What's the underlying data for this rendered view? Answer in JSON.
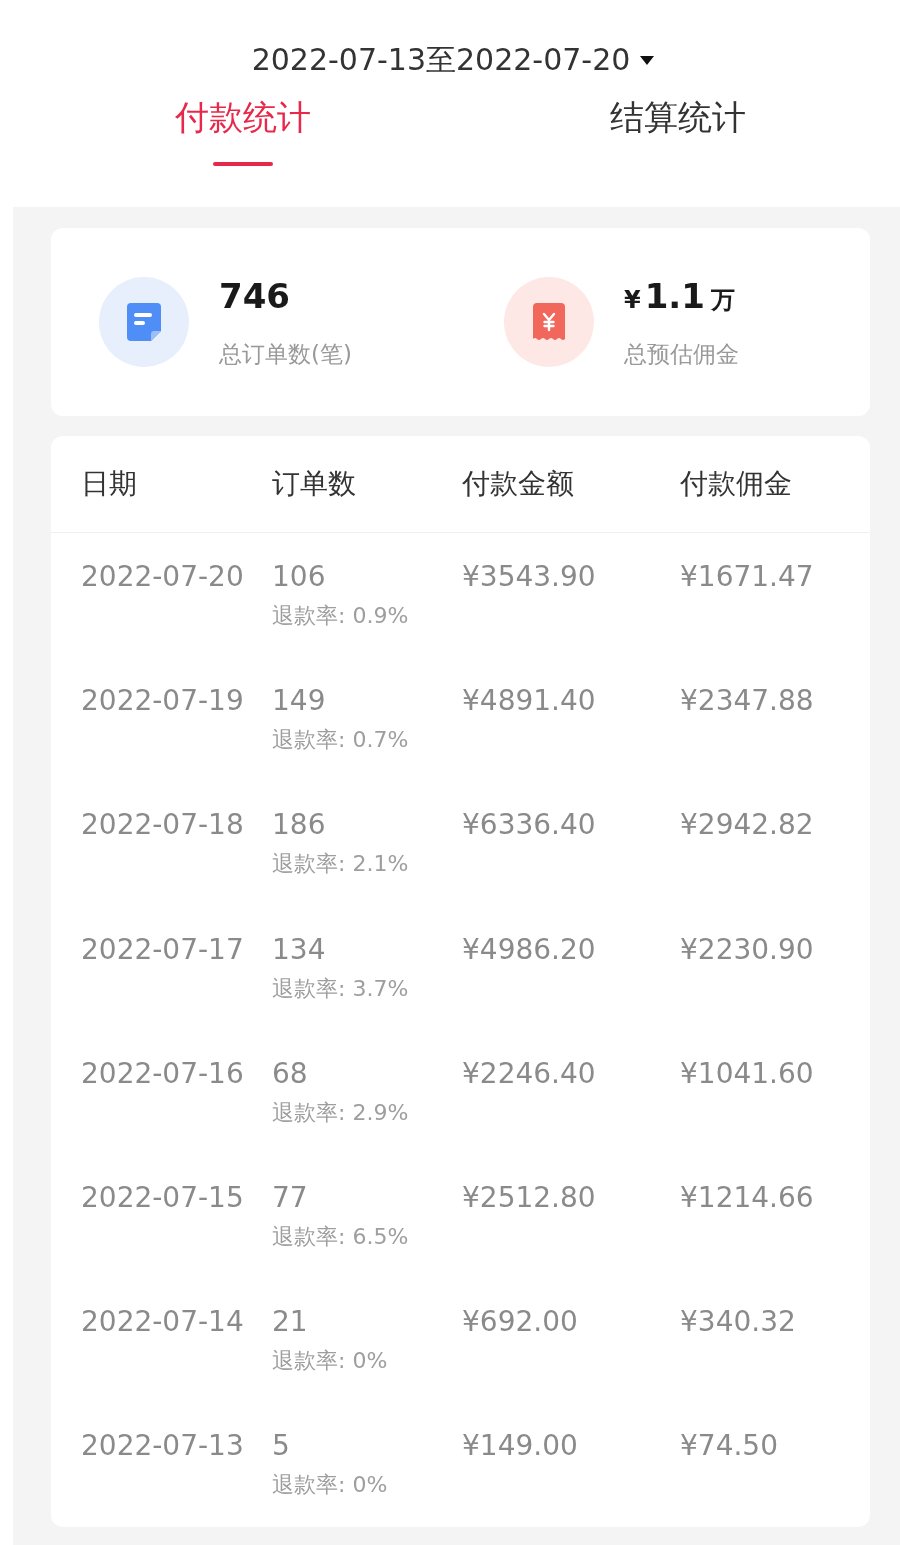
{
  "date_range": "2022-07-13至2022-07-20",
  "tabs": [
    {
      "label": "付款统计",
      "selected": true
    },
    {
      "label": "结算统计",
      "selected": false
    }
  ],
  "summary": [
    {
      "kind": "orders",
      "value": "746",
      "label": "总订单数(笔)"
    },
    {
      "kind": "commission",
      "currency": "¥",
      "value": "1.1",
      "unit": "万",
      "label": "总预估佣金"
    }
  ],
  "table": {
    "columns": [
      "日期",
      "订单数",
      "付款金额",
      "付款佣金"
    ],
    "rows": [
      {
        "date": "2022-07-20",
        "orders": "106",
        "refund_rate": "退款率: 0.9%",
        "amount": "¥3543.90",
        "commission": "¥1671.47"
      },
      {
        "date": "2022-07-19",
        "orders": "149",
        "refund_rate": "退款率: 0.7%",
        "amount": "¥4891.40",
        "commission": "¥2347.88"
      },
      {
        "date": "2022-07-18",
        "orders": "186",
        "refund_rate": "退款率: 2.1%",
        "amount": "¥6336.40",
        "commission": "¥2942.82"
      },
      {
        "date": "2022-07-17",
        "orders": "134",
        "refund_rate": "退款率: 3.7%",
        "amount": "¥4986.20",
        "commission": "¥2230.90"
      },
      {
        "date": "2022-07-16",
        "orders": "68",
        "refund_rate": "退款率: 2.9%",
        "amount": "¥2246.40",
        "commission": "¥1041.60"
      },
      {
        "date": "2022-07-15",
        "orders": "77",
        "refund_rate": "退款率: 6.5%",
        "amount": "¥2512.80",
        "commission": "¥1214.66"
      },
      {
        "date": "2022-07-14",
        "orders": "21",
        "refund_rate": "退款率: 0%",
        "amount": "¥692.00",
        "commission": "¥340.32"
      },
      {
        "date": "2022-07-13",
        "orders": "5",
        "refund_rate": "退款率: 0%",
        "amount": "¥149.00",
        "commission": "¥74.50"
      }
    ]
  }
}
